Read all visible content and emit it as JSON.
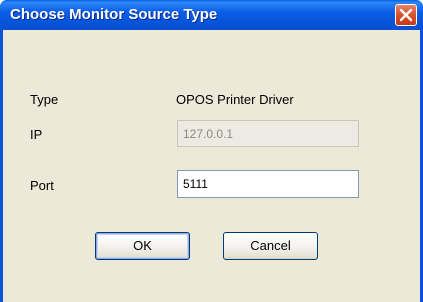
{
  "window": {
    "title": "Choose Monitor Source Type",
    "close_icon": "close-icon"
  },
  "form": {
    "type_label": "Type",
    "type_value": "OPOS Printer Driver",
    "ip_label": "IP",
    "ip_value": "127.0.0.1",
    "port_label": "Port",
    "port_value": "5111"
  },
  "buttons": {
    "ok_label": "OK",
    "cancel_label": "Cancel"
  },
  "colors": {
    "title_bar": "#0554d9",
    "close_button": "#d8522c",
    "dialog_face": "#ece9d8"
  }
}
